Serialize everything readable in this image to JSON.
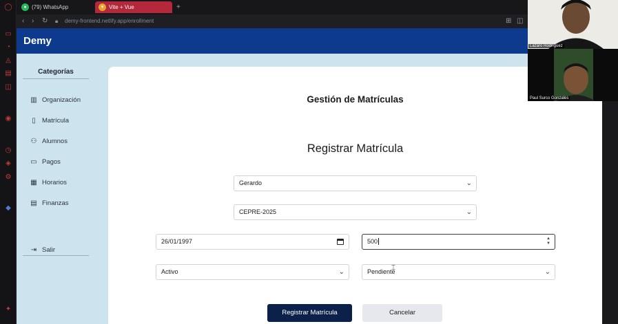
{
  "browser": {
    "tabs": [
      {
        "label": "(79) WhatsApp",
        "icon": "whatsapp-icon",
        "active": false
      },
      {
        "label": "Vite + Vue",
        "icon": "vue-icon",
        "active": true
      }
    ],
    "new_tab_glyph": "+",
    "url": "demy-frontend.netlify.app/enrollment"
  },
  "app": {
    "brand": "Demy",
    "sidebar": {
      "title": "Categorías",
      "items": [
        {
          "label": "Organización",
          "icon": "building-icon"
        },
        {
          "label": "Matrícula",
          "icon": "document-icon"
        },
        {
          "label": "Alumnos",
          "icon": "users-icon"
        },
        {
          "label": "Pagos",
          "icon": "card-icon"
        },
        {
          "label": "Horarios",
          "icon": "calendar-icon"
        },
        {
          "label": "Finanzas",
          "icon": "folder-icon"
        }
      ],
      "logout": {
        "label": "Salir",
        "icon": "logout-icon"
      }
    },
    "main": {
      "page_title": "Gestión de Matrículas",
      "form_title": "Registrar Matrícula",
      "fields": {
        "student": "Gerardo",
        "cycle": "CEPRE-2025",
        "date": "26/01/1997",
        "amount": "500",
        "status": "Activo",
        "payment_status": "Pendiente"
      },
      "buttons": {
        "submit": "Registrar Matrícula",
        "cancel": "Cancelar"
      }
    }
  },
  "video_call": {
    "participants": [
      {
        "name": "Lazaro Rodríguez"
      },
      {
        "name": "Paul Surco Gonzales"
      }
    ]
  },
  "colors": {
    "appbar": "#0d3a8c",
    "app_background": "#cde4ee",
    "primary_button": "#0c2149",
    "active_tab": "#b3283a"
  }
}
